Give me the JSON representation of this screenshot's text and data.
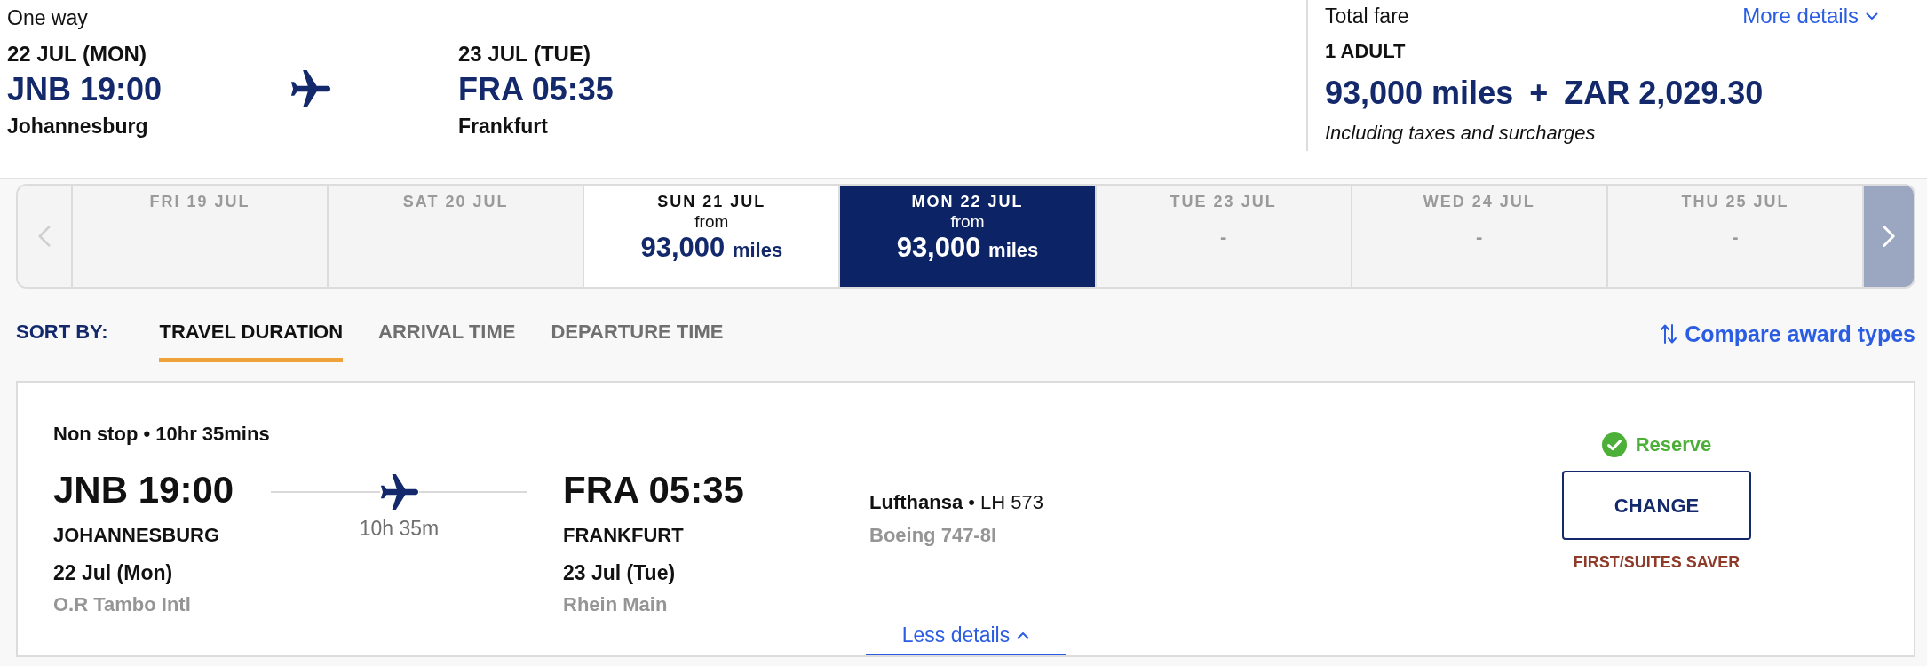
{
  "header": {
    "trip_type": "One way",
    "departure": {
      "date": "22 JUL (MON)",
      "airport_time": "JNB 19:00",
      "city": "Johannesburg"
    },
    "arrival": {
      "date": "23 JUL (TUE)",
      "airport_time": "FRA 05:35",
      "city": "Frankfurt"
    }
  },
  "fare": {
    "title": "Total fare",
    "details_link": {
      "label": "More details",
      "expanded": false
    },
    "passengers": "1 ADULT",
    "miles": "93,000 miles",
    "plus": "+",
    "cash": "ZAR 2,029.30",
    "note": "Including taxes and surcharges"
  },
  "date_strip": {
    "previous": {
      "disabled": true
    },
    "next": {
      "disabled": false
    },
    "days": [
      {
        "label": "FRI 19 JUL",
        "available": false,
        "selected": false
      },
      {
        "label": "SAT 20 JUL",
        "available": false,
        "selected": false
      },
      {
        "label": "SUN 21 JUL",
        "available": true,
        "selected": false,
        "from": "from",
        "amount": "93,000",
        "unit": "miles"
      },
      {
        "label": "MON 22 JUL",
        "available": true,
        "selected": true,
        "from": "from",
        "amount": "93,000",
        "unit": "miles"
      },
      {
        "label": "TUE 23 JUL",
        "available": false,
        "selected": false,
        "price": "-"
      },
      {
        "label": "WED 24 JUL",
        "available": false,
        "selected": false,
        "price": "-"
      },
      {
        "label": "THU 25 JUL",
        "available": false,
        "selected": false,
        "price": "-"
      }
    ]
  },
  "sort": {
    "label": "SORT BY:",
    "tabs": [
      {
        "label": "TRAVEL DURATION",
        "selected": true
      },
      {
        "label": "ARRIVAL TIME",
        "selected": false
      },
      {
        "label": "DEPARTURE TIME",
        "selected": false
      }
    ],
    "compare_link": "Compare award types"
  },
  "flights": [
    {
      "summary": "Non stop • 10hr 35mins",
      "departure": {
        "airport_time": "JNB 19:00",
        "city": "JOHANNESBURG",
        "date": "22 Jul (Mon)",
        "airport": "O.R Tambo Intl"
      },
      "duration": "10h 35m",
      "arrival": {
        "airport_time": "FRA 05:35",
        "city": "FRANKFURT",
        "date": "23 Jul (Tue)",
        "airport": "Rhein Main"
      },
      "carrier": "**Lufthansa** • LH 573",
      "aircraft": "Boeing 747-8I",
      "status": "Reserve",
      "action": "CHANGE",
      "fare_class": "FIRST/SUITES SAVER",
      "details_toggle": {
        "label": "Less details",
        "expanded": true
      }
    }
  ]
}
